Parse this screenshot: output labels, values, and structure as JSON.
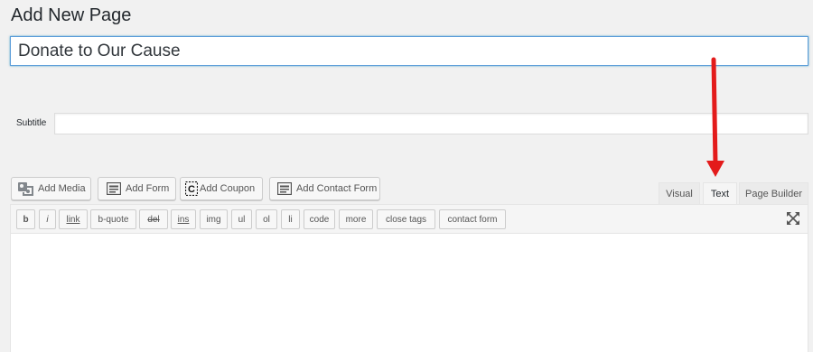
{
  "header": {
    "title": "Add New Page"
  },
  "post": {
    "title_value": "Donate to Our Cause"
  },
  "subtitle": {
    "label": "Subtitle",
    "value": ""
  },
  "media_buttons": [
    {
      "label": "Add Media",
      "icon": "media-icon"
    },
    {
      "label": "Add Form",
      "icon": "form-icon"
    },
    {
      "label": "Add Coupon",
      "icon": "coupon-icon"
    },
    {
      "label": "Add Contact Form",
      "icon": "form-icon"
    }
  ],
  "editor_tabs": [
    {
      "label": "Visual",
      "active": false
    },
    {
      "label": "Text",
      "active": true
    },
    {
      "label": "Page Builder",
      "active": false
    }
  ],
  "quicktags": [
    "b",
    "i",
    "link",
    "b-quote",
    "del",
    "ins",
    "img",
    "ul",
    "ol",
    "li",
    "code",
    "more",
    "close tags",
    "contact form"
  ],
  "annotation": {
    "type": "arrow",
    "color": "#e31b1b",
    "points_to": "Text tab"
  }
}
